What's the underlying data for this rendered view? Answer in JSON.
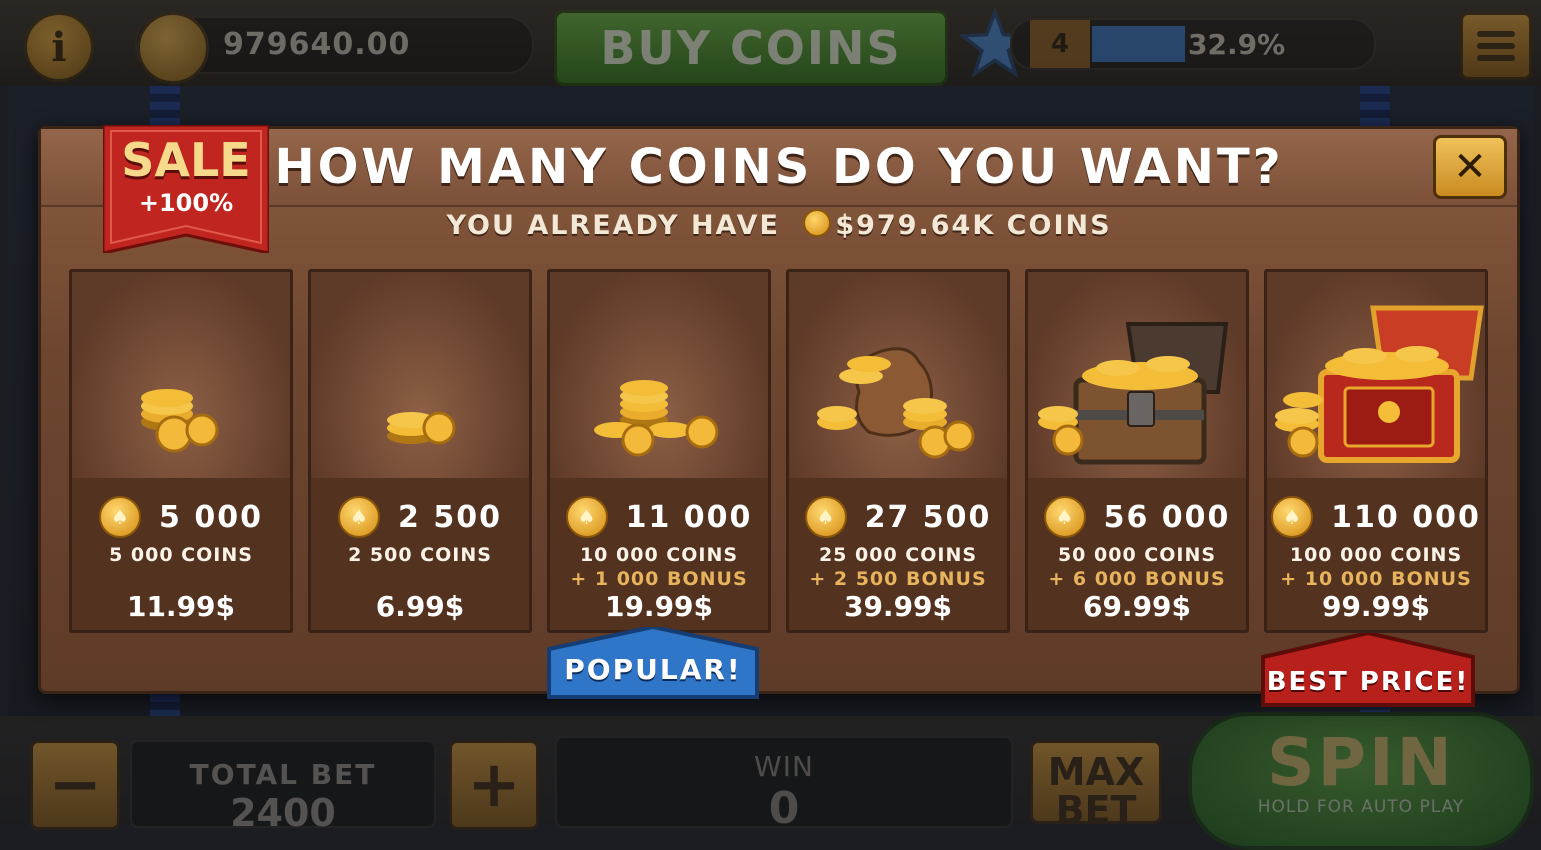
{
  "topbar": {
    "balance": "979640.00",
    "buy_coins_label": "BUY COINS",
    "level": "4",
    "xp_percent_text": "32.9%",
    "xp_progress": 0.329
  },
  "modal": {
    "title": "HOW MANY COINS DO YOU WANT?",
    "subtitle_prefix": "YOU ALREADY HAVE",
    "subtitle_amount": "$979.64K",
    "subtitle_suffix": "COINS",
    "close_icon": "close-icon",
    "sale_label": "SALE",
    "sale_sub": "+100%",
    "popular_label": "POPULAR!",
    "best_price_label": "BEST PRICE!"
  },
  "packages": [
    {
      "amount": "5 000",
      "coins": "5 000 COINS",
      "bonus": "",
      "price": "11.99$",
      "art": "small-stack"
    },
    {
      "amount": "2 500",
      "coins": "2 500 COINS",
      "bonus": "",
      "price": "6.99$",
      "art": "tiny-stack"
    },
    {
      "amount": "11 000",
      "coins": "10 000 COINS",
      "bonus": "+ 1 000 BONUS",
      "price": "19.99$",
      "art": "stacks"
    },
    {
      "amount": "27 500",
      "coins": "25 000 COINS",
      "bonus": "+ 2 500 BONUS",
      "price": "39.99$",
      "art": "coin-sack"
    },
    {
      "amount": "56 000",
      "coins": "50 000 COINS",
      "bonus": "+ 6 000 BONUS",
      "price": "69.99$",
      "art": "wooden-chest"
    },
    {
      "amount": "110 000",
      "coins": "100 000 COINS",
      "bonus": "+ 10 000 BONUS",
      "price": "99.99$",
      "art": "red-chest"
    }
  ],
  "bottombar": {
    "minus_label": "−",
    "plus_label": "+",
    "total_bet_label": "TOTAL BET",
    "total_bet_value": "2400",
    "win_label": "WIN",
    "win_value": "0",
    "max_bet_line1": "MAX",
    "max_bet_line2": "BET",
    "spin_label": "SPIN",
    "spin_sub": "HOLD FOR AUTO PLAY"
  },
  "colors": {
    "modal_bg": "#6e4630",
    "coin_gold": "#f0b030",
    "popular_blue": "#2f76c8",
    "best_price_red": "#b8201c"
  }
}
